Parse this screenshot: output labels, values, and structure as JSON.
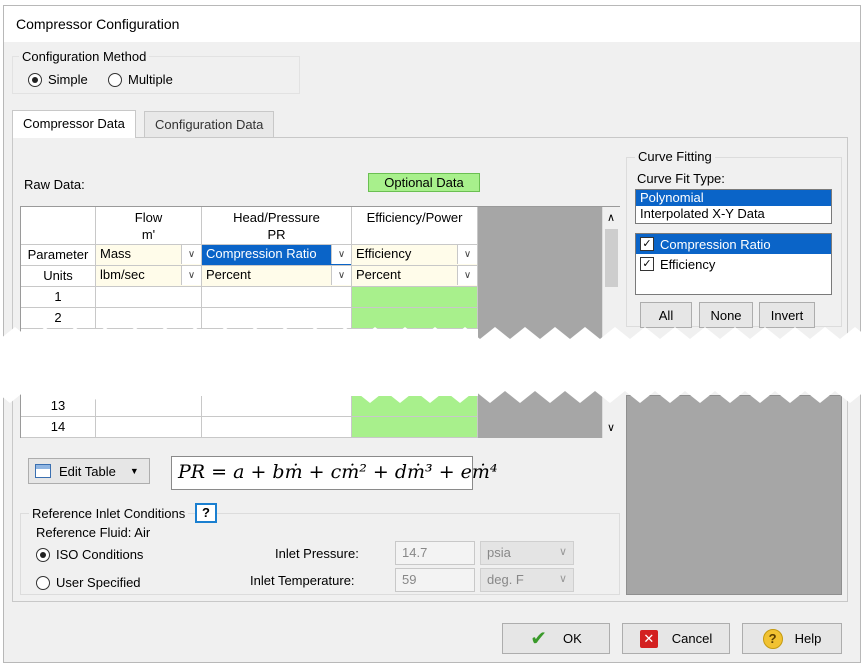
{
  "window": {
    "title": "Compressor Configuration"
  },
  "config_method": {
    "label": "Configuration Method",
    "options": [
      {
        "label": "Simple",
        "selected": true
      },
      {
        "label": "Multiple",
        "selected": false
      }
    ]
  },
  "tabs": [
    {
      "label": "Compressor Data",
      "active": true
    },
    {
      "label": "Configuration Data",
      "active": false
    }
  ],
  "raw_data": {
    "label": "Raw Data:",
    "optional_label": "Optional Data",
    "columns": [
      {
        "line1": "Flow",
        "line2": "m'"
      },
      {
        "line1": "Head/Pressure",
        "line2": "PR"
      },
      {
        "line1": "Efficiency/Power",
        "line2": ""
      }
    ],
    "parameter_label": "Parameter",
    "units_label": "Units",
    "parameters": [
      "Mass",
      "Compression Ratio",
      "Efficiency"
    ],
    "units": [
      "lbm/sec",
      "Percent",
      "Percent"
    ],
    "row_numbers": [
      "1",
      "2",
      "13",
      "14"
    ]
  },
  "edit_table": {
    "label": "Edit Table"
  },
  "formula": "PR = a + bṁ + cṁ² + dṁ³ + eṁ⁴",
  "curve_fitting": {
    "label": "Curve Fitting",
    "type_label": "Curve Fit Type:",
    "types": [
      {
        "label": "Polynomial",
        "selected": true
      },
      {
        "label": "Interpolated X-Y Data",
        "selected": false
      }
    ],
    "curves": [
      {
        "label": "Compression Ratio",
        "checked": true,
        "selected": true
      },
      {
        "label": "Efficiency",
        "checked": true,
        "selected": false
      }
    ],
    "buttons": {
      "all": "All",
      "none": "None",
      "invert": "Invert"
    }
  },
  "reference": {
    "label": "Reference Inlet Conditions",
    "help": "?",
    "fluid": "Reference Fluid: Air",
    "options": [
      {
        "label": "ISO Conditions",
        "selected": true
      },
      {
        "label": "User Specified",
        "selected": false
      }
    ],
    "inlet_pressure": {
      "label": "Inlet Pressure:",
      "value": "14.7",
      "unit": "psia"
    },
    "inlet_temperature": {
      "label": "Inlet Temperature:",
      "value": "59",
      "unit": "deg. F"
    }
  },
  "footer": {
    "ok": "OK",
    "cancel": "Cancel",
    "help": "Help"
  },
  "colors": {
    "optional": "#a8f08c",
    "selection": "#0a64c8",
    "cream": "#fffcea",
    "unused": "#a6a6a6"
  }
}
